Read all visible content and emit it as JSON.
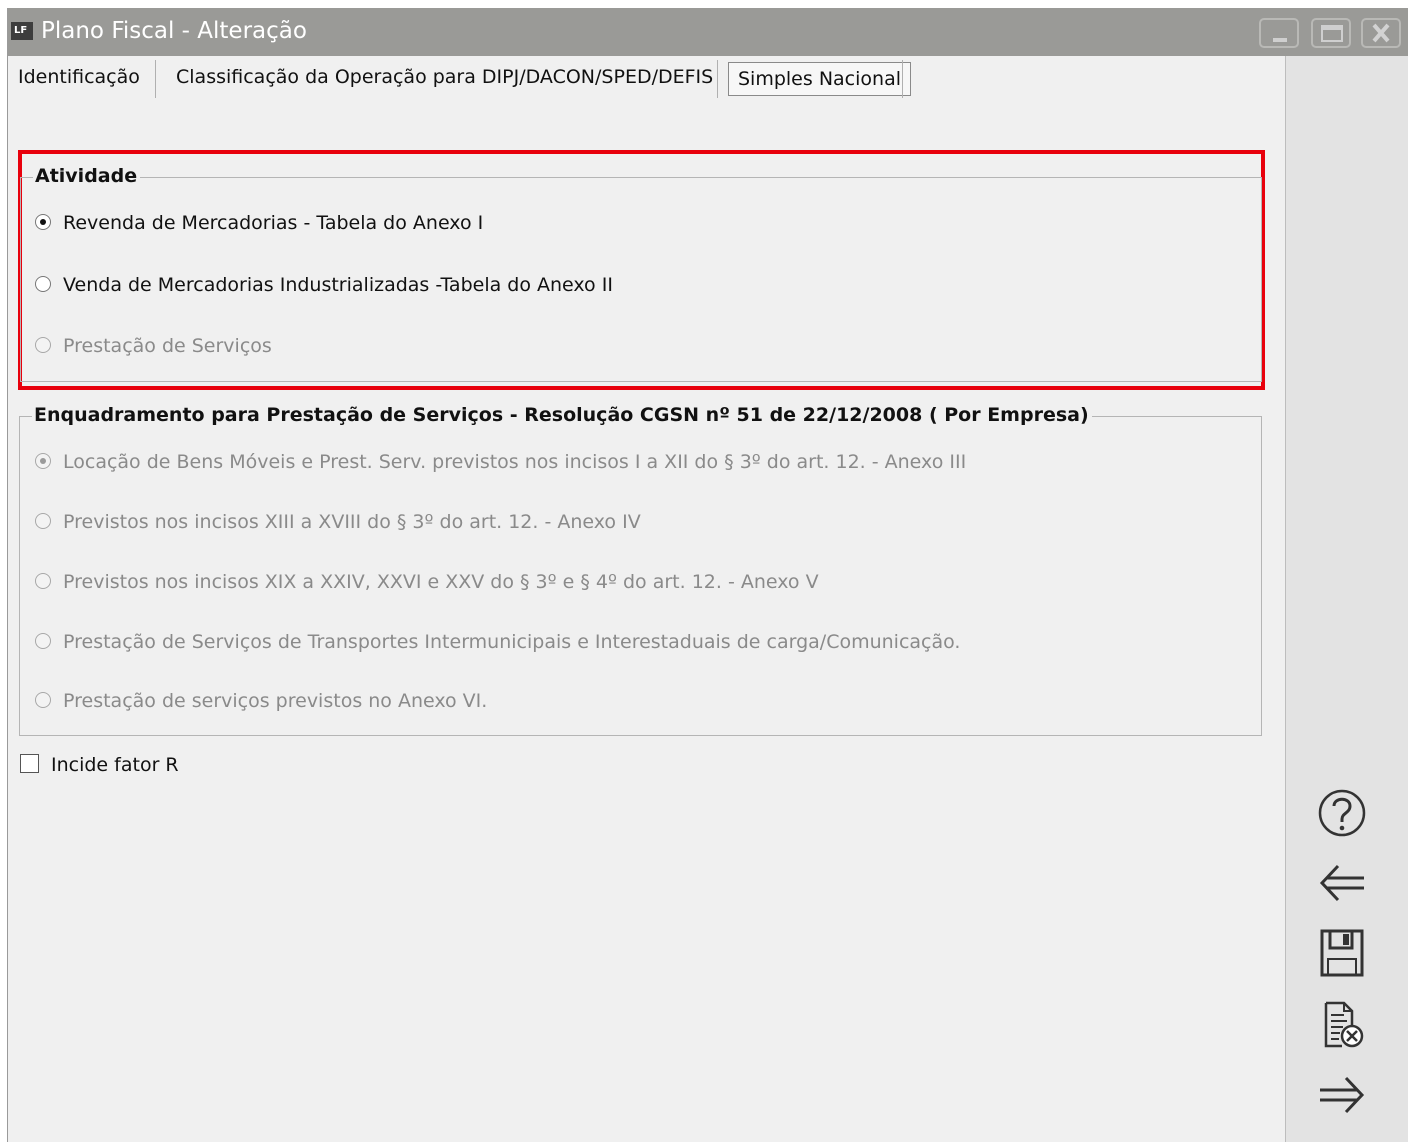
{
  "window": {
    "title": "Plano Fiscal - Alteração",
    "app_icon_text": "LF"
  },
  "tabs": [
    {
      "label": "Identificação"
    },
    {
      "label": "Classificação da Operação para DIPJ/DACON/SPED/DEFIS"
    },
    {
      "label": "Simples Nacional",
      "active": true
    }
  ],
  "atividade": {
    "legend": "Atividade",
    "highlight_color": "#e8000c",
    "options": [
      {
        "label": "Revenda de Mercadorias - Tabela do Anexo I",
        "checked": true,
        "enabled": true
      },
      {
        "label": "Venda de Mercadorias Industrializadas -Tabela do Anexo II",
        "checked": false,
        "enabled": true
      },
      {
        "label": "Prestação de Serviços",
        "checked": false,
        "enabled": false
      }
    ]
  },
  "enquadramento": {
    "legend": "Enquadramento para Prestação de Serviços -  Resolução CGSN nº 51 de 22/12/2008 ( Por Empresa)",
    "options": [
      {
        "label": "Locação de Bens Móveis e Prest. Serv. previstos nos incisos I a XII do § 3º do art. 12. - Anexo III",
        "checked": true,
        "enabled": false
      },
      {
        "label": "Previstos nos incisos XIII a XVIII do § 3º do art. 12. - Anexo IV",
        "checked": false,
        "enabled": false
      },
      {
        "label": "Previstos nos incisos XIX a XXIV, XXVI e XXV do § 3º e § 4º do art. 12. - Anexo V",
        "checked": false,
        "enabled": false
      },
      {
        "label": "Prestação de Serviços de Transportes Intermunicipais e Interestaduais de carga/Comunicação.",
        "checked": false,
        "enabled": false
      },
      {
        "label": "Prestação de serviços previstos no Anexo VI.",
        "checked": false,
        "enabled": false
      }
    ]
  },
  "fator_r": {
    "label": "Incide fator R",
    "checked": false
  },
  "toolbar": [
    {
      "icon": "help-icon"
    },
    {
      "icon": "back-arrow-icon"
    },
    {
      "icon": "save-icon"
    },
    {
      "icon": "cancel-document-icon"
    },
    {
      "icon": "forward-arrow-icon"
    }
  ]
}
